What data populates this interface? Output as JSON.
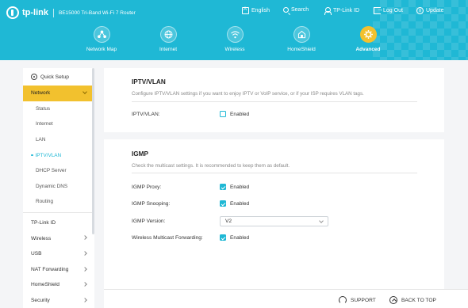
{
  "app": {
    "brand": "tp-link",
    "model": "BE15000 Tri-Band Wi-Fi 7 Router"
  },
  "top_links": {
    "english": "English",
    "search": "Search",
    "tplink_id": "TP-Link ID",
    "logout": "Log Out",
    "update": "Update"
  },
  "nav": {
    "network_map": "Network Map",
    "internet": "Internet",
    "wireless": "Wireless",
    "homeshield": "HomeShield",
    "advanced": "Advanced",
    "active": "Advanced"
  },
  "sidebar": {
    "quick_setup": "Quick Setup",
    "network": "Network",
    "sub": {
      "status": "Status",
      "internet": "Internet",
      "lan": "LAN",
      "iptv": "IPTV/VLAN",
      "dhcp": "DHCP Server",
      "ddns": "Dynamic DNS",
      "routing": "Routing"
    },
    "tplink_id": "TP-Link ID",
    "wireless": "Wireless",
    "usb": "USB",
    "nat": "NAT Forwarding",
    "homeshield": "HomeShield",
    "security": "Security"
  },
  "iptv": {
    "title": "IPTV/VLAN",
    "desc": "Configure IPTV/VLAN settings if you want to enjoy IPTV or VoIP service, or if your ISP requires VLAN tags.",
    "label": "IPTV/VLAN:",
    "option": "Enabled",
    "checked": false
  },
  "igmp": {
    "title": "IGMP",
    "desc": "Check the multicast settings. It is recommended to keep them as default.",
    "proxy_label": "IGMP Proxy:",
    "proxy_value": "Enabled",
    "snooping_label": "IGMP Snooping:",
    "snooping_value": "Enabled",
    "version_label": "IGMP Version:",
    "version_value": "V2",
    "wmf_label": "Wireless Multicast Forwarding:",
    "wmf_value": "Enabled"
  },
  "footer": {
    "support": "SUPPORT",
    "back_to_top": "BACK TO TOP"
  },
  "colors": {
    "header": "#1fb8d5",
    "accent": "#f2c12e",
    "checkbox": "#1fb8d5"
  }
}
